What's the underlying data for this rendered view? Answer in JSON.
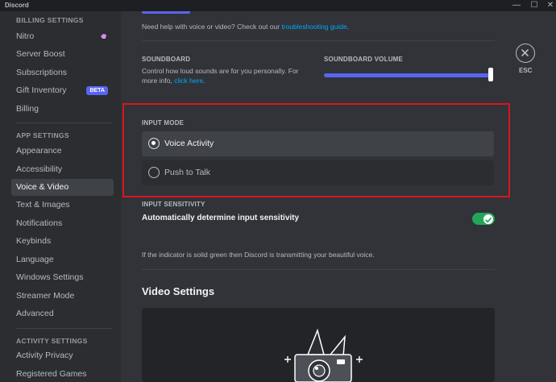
{
  "window": {
    "title": "Discord",
    "min": "—",
    "max": "☐",
    "close": "✕"
  },
  "sidebar": {
    "billing_header": "BILLING SETTINGS",
    "billing_items": [
      {
        "label": "Nitro"
      },
      {
        "label": "Server Boost"
      },
      {
        "label": "Subscriptions"
      },
      {
        "label": "Gift Inventory",
        "badge": "BETA"
      },
      {
        "label": "Billing"
      }
    ],
    "app_header": "APP SETTINGS",
    "app_items": [
      {
        "label": "Appearance"
      },
      {
        "label": "Accessibility"
      },
      {
        "label": "Voice & Video",
        "active": true
      },
      {
        "label": "Text & Images"
      },
      {
        "label": "Notifications"
      },
      {
        "label": "Keybinds"
      },
      {
        "label": "Language"
      },
      {
        "label": "Windows Settings"
      },
      {
        "label": "Streamer Mode"
      },
      {
        "label": "Advanced"
      }
    ],
    "activity_header": "ACTIVITY SETTINGS",
    "activity_items": [
      {
        "label": "Activity Privacy"
      },
      {
        "label": "Registered Games"
      }
    ]
  },
  "main": {
    "help_prefix": "Need help with voice or video? Check out our ",
    "help_link": "troubleshooting guide",
    "help_suffix": ".",
    "soundboard": {
      "label": "SOUNDBOARD",
      "desc_line1": "Control how loud sounds are for you personally. For",
      "desc_line2_prefix": "more info, ",
      "desc_link": "click here",
      "desc_suffix": ".",
      "volume_label": "SOUNDBOARD VOLUME",
      "volume_level": 1.0
    },
    "esc": {
      "label": "ESC"
    },
    "input_mode": {
      "label": "INPUT MODE",
      "options": [
        {
          "label": "Voice Activity",
          "selected": true
        },
        {
          "label": "Push to Talk",
          "selected": false
        }
      ]
    },
    "input_sensitivity": {
      "label": "INPUT SENSITIVITY",
      "auto_label": "Automatically determine input sensitivity",
      "auto_enabled": true,
      "hint": "If the indicator is solid green then Discord is transmitting your beautiful voice."
    },
    "video_settings_title": "Video Settings"
  },
  "colors": {
    "accent": "#5865f2",
    "toggle_on": "#23a55a",
    "highlight": "#d7161c",
    "link": "#00a8fc"
  }
}
